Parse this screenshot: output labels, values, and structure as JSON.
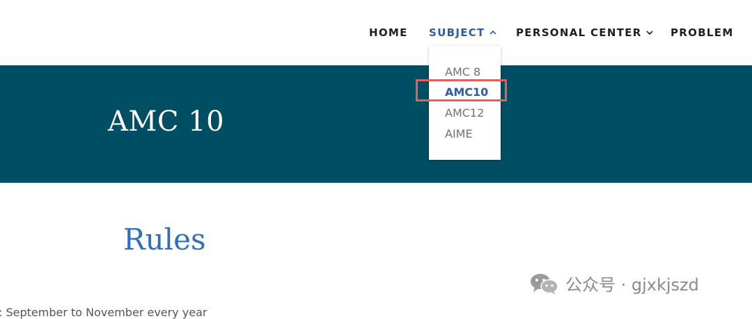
{
  "nav": {
    "items": [
      {
        "label": "HOME"
      },
      {
        "label": "SUBJECT"
      },
      {
        "label": "PERSONAL CENTER"
      },
      {
        "label": "PROBLEM"
      }
    ],
    "active_index": 1
  },
  "dropdown": {
    "items": [
      "AMC 8",
      "AMC10",
      "AMC12",
      "AIME"
    ],
    "selected_index": 1
  },
  "banner": {
    "title": "AMC 10"
  },
  "content": {
    "heading": "Rules",
    "partial_line": ": September to November every year"
  },
  "watermark": {
    "text": "公众号 · gjxkjszd"
  },
  "colors": {
    "banner_bg": "#004e64",
    "accent": "#2c5ea8",
    "highlight_border": "#e0625a",
    "heading": "#2c6fbf"
  },
  "icons": {
    "chevron_up": "chevron-up-icon",
    "chevron_down": "chevron-down-icon",
    "wechat": "wechat-icon"
  }
}
